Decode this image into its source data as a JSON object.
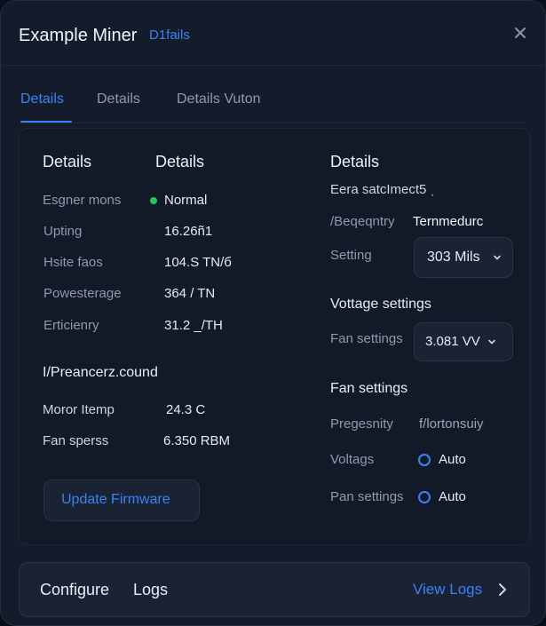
{
  "window": {
    "title": "Example Miner",
    "title_status": "D1fails"
  },
  "tabs": [
    {
      "label": "Details"
    },
    {
      "label": "Details"
    },
    {
      "label": "Details Vuton"
    }
  ],
  "left_column": {
    "header_1": "Details",
    "header_2": "Details",
    "rows": [
      {
        "label": "Esgner mons",
        "value": "Normal"
      },
      {
        "label": "Upting",
        "value": "16.26ñ1"
      },
      {
        "label": "Hsite faos",
        "value": "104.S TN/б"
      },
      {
        "label": "Powesterage",
        "value": "364 / TN"
      },
      {
        "label": "Erticienry",
        "value": "31.2 _/TH"
      }
    ],
    "section_title": "I/Preancerz.cound",
    "sensor_rows": [
      {
        "label": "Moror Itemp",
        "value": "24.3 C"
      },
      {
        "label": "Fan sperss",
        "value": "6.350 RBM"
      }
    ],
    "update_firmware_label": "Update Firmware"
  },
  "right_column": {
    "header": "Details",
    "subtitle": "Eera satcImect5 ˌ",
    "frequency_label": "/Beqeqntry",
    "frequency_value": "Ternmedurc",
    "setting_label": "Setting",
    "setting_value": "303 Mils",
    "voltage_section": "Vottage settings",
    "fan_settings_label": "Fan settings",
    "fan_settings_value": "3.081 VV",
    "fan_section": "Fan settings",
    "pregesnity_label": "Pregesnity",
    "pregesnity_value": "f/lortonsuiy",
    "voltags_label": "Voltags",
    "voltags_value": "Auto",
    "pan_settings_label": "Pan settings",
    "pan_settings_value": "Auto"
  },
  "footer": {
    "configure": "Configure",
    "logs": "Logs",
    "view_logs": "View Logs"
  },
  "colors": {
    "accent": "#3b82f6",
    "status_ok": "#22c55e"
  },
  "icons": [
    "close-icon",
    "status-dot-icon",
    "chevron-down-icon",
    "chevron-right-icon",
    "auto-mode-icon"
  ]
}
